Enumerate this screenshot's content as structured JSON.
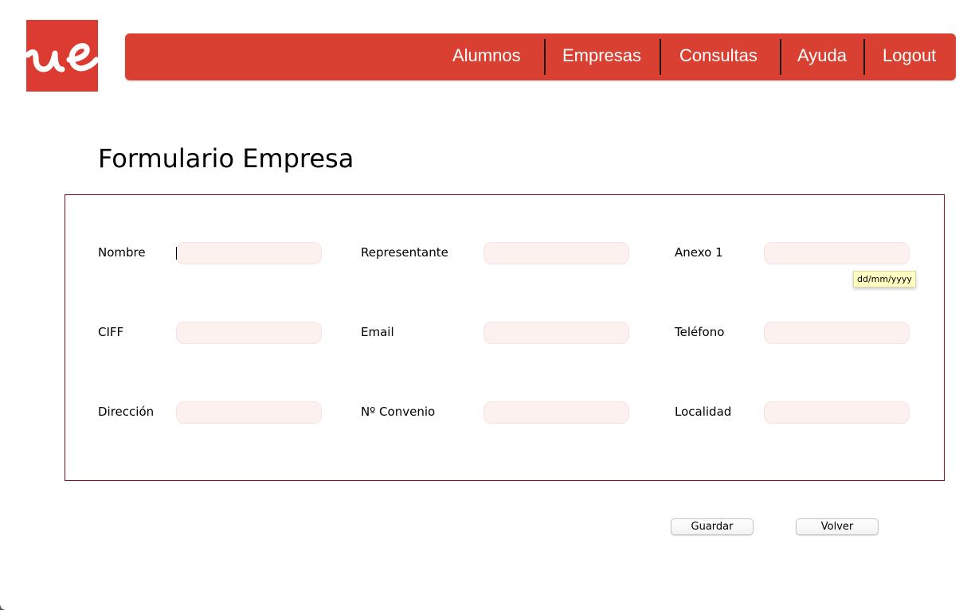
{
  "logo": {
    "text": "ue",
    "color": "#dc3b32"
  },
  "nav": {
    "color": "#d94032",
    "items": [
      {
        "label": "Alumnos"
      },
      {
        "label": "Empresas"
      },
      {
        "label": "Consultas"
      },
      {
        "label": "Ayuda"
      },
      {
        "label": "Logout"
      }
    ]
  },
  "page_title": "Formulario Empresa",
  "form": {
    "fields": {
      "nombre": {
        "label": "Nombre",
        "value": "",
        "placeholder": ""
      },
      "representante": {
        "label": "Representante",
        "value": "",
        "placeholder": ""
      },
      "anexo1": {
        "label": "Anexo 1",
        "value": "",
        "placeholder": ""
      },
      "ciff": {
        "label": "CIFF",
        "value": "",
        "placeholder": ""
      },
      "email": {
        "label": "Email",
        "value": "",
        "placeholder": ""
      },
      "telefono": {
        "label": "Teléfono",
        "value": "",
        "placeholder": ""
      },
      "direccion": {
        "label": "Dirección",
        "value": "",
        "placeholder": ""
      },
      "convenio": {
        "label": "Nº Convenio",
        "value": "",
        "placeholder": ""
      },
      "localidad": {
        "label": "Localidad",
        "value": "",
        "placeholder": ""
      }
    },
    "date_tooltip": "dd/mm/yyyy"
  },
  "buttons": {
    "save_label": "Guardar",
    "back_label": "Volver"
  }
}
